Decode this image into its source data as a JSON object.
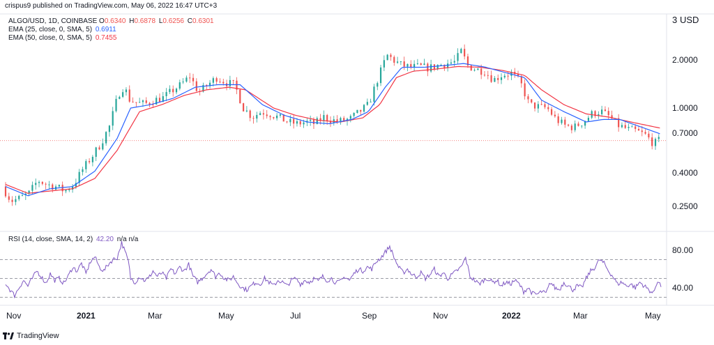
{
  "publisher": "crispus9 published on TradingView.com, May 06, 2022 16:47 UTC+3",
  "branding": "TradingView",
  "legend": {
    "symbol": "ALGO/USD, 1D, COINBASE",
    "ohlc": [
      {
        "label": "O",
        "value": "0.6340"
      },
      {
        "label": "H",
        "value": "0.6878"
      },
      {
        "label": "L",
        "value": "0.6256"
      },
      {
        "label": "C",
        "value": "0.6301"
      }
    ],
    "ema25": {
      "label": "EMA (25, close, 0, SMA, 5)",
      "value": "0.6911",
      "color": "#2962ff"
    },
    "ema50": {
      "label": "EMA (50, close, 0, SMA, 5)",
      "value": "0.7455",
      "color": "#f23645"
    },
    "rsi": {
      "label": "RSI (14, close, SMA, 14, 2)",
      "value": "42.20",
      "extra": "n/a n/a",
      "color": "#7e57c2"
    }
  },
  "currency": "USD",
  "currency_prefix": "3",
  "chart_data": [
    {
      "type": "candlestick",
      "scale": "log",
      "y_ticks": [
        "2.0000",
        "1.0000",
        "0.7000",
        "0.4000",
        "0.2500"
      ],
      "y_tick_values": [
        2.0,
        1.0,
        0.7,
        0.4,
        0.25
      ],
      "ylim": [
        0.2,
        3.0
      ],
      "x_ticks": [
        "Nov",
        "2021",
        "Mar",
        "May",
        "Jul",
        "Sep",
        "Nov",
        "2022",
        "Mar",
        "May"
      ],
      "colors": {
        "up": "#26a69a",
        "down": "#ef5350"
      },
      "price_line": 0.6301,
      "close": [
        [
          0,
          0.33
        ],
        [
          8,
          0.27
        ],
        [
          16,
          0.28
        ],
        [
          24,
          0.3
        ],
        [
          32,
          0.36
        ],
        [
          40,
          0.34
        ],
        [
          48,
          0.33
        ],
        [
          56,
          0.31
        ],
        [
          64,
          0.34
        ],
        [
          72,
          0.42
        ],
        [
          80,
          0.5
        ],
        [
          88,
          0.6
        ],
        [
          96,
          0.77
        ],
        [
          104,
          1.22
        ],
        [
          110,
          1.4
        ],
        [
          112,
          1.15
        ],
        [
          120,
          1.08
        ],
        [
          128,
          1.06
        ],
        [
          136,
          1.12
        ],
        [
          144,
          1.16
        ],
        [
          152,
          1.28
        ],
        [
          160,
          1.4
        ],
        [
          168,
          1.58
        ],
        [
          176,
          1.25
        ],
        [
          184,
          1.4
        ],
        [
          192,
          1.55
        ],
        [
          200,
          1.45
        ],
        [
          208,
          1.4
        ],
        [
          216,
          1.0
        ],
        [
          224,
          0.88
        ],
        [
          232,
          0.95
        ],
        [
          240,
          0.92
        ],
        [
          248,
          0.87
        ],
        [
          256,
          0.82
        ],
        [
          264,
          0.8
        ],
        [
          272,
          0.82
        ],
        [
          280,
          0.8
        ],
        [
          288,
          0.88
        ],
        [
          296,
          0.84
        ],
        [
          304,
          0.83
        ],
        [
          312,
          0.86
        ],
        [
          320,
          0.95
        ],
        [
          328,
          1.05
        ],
        [
          336,
          1.5
        ],
        [
          344,
          2.1
        ],
        [
          350,
          2.0
        ],
        [
          358,
          1.85
        ],
        [
          366,
          1.8
        ],
        [
          374,
          1.82
        ],
        [
          382,
          1.78
        ],
        [
          390,
          1.85
        ],
        [
          398,
          1.9
        ],
        [
          406,
          1.95
        ],
        [
          412,
          2.2
        ],
        [
          416,
          1.85
        ],
        [
          424,
          1.75
        ],
        [
          432,
          1.7
        ],
        [
          440,
          1.5
        ],
        [
          448,
          1.62
        ],
        [
          456,
          1.65
        ],
        [
          464,
          1.45
        ],
        [
          472,
          1.05
        ],
        [
          480,
          1.02
        ],
        [
          488,
          1.0
        ],
        [
          496,
          0.85
        ],
        [
          504,
          0.78
        ],
        [
          512,
          0.76
        ],
        [
          520,
          0.82
        ],
        [
          528,
          0.92
        ],
        [
          536,
          0.96
        ],
        [
          544,
          0.88
        ],
        [
          552,
          0.78
        ],
        [
          560,
          0.74
        ],
        [
          568,
          0.72
        ],
        [
          576,
          0.68
        ],
        [
          584,
          0.6
        ],
        [
          587,
          0.63
        ]
      ],
      "ema25": [
        [
          0,
          0.33
        ],
        [
          20,
          0.29
        ],
        [
          40,
          0.32
        ],
        [
          60,
          0.33
        ],
        [
          80,
          0.41
        ],
        [
          100,
          0.65
        ],
        [
          112,
          1.0
        ],
        [
          130,
          1.05
        ],
        [
          150,
          1.15
        ],
        [
          170,
          1.35
        ],
        [
          190,
          1.4
        ],
        [
          210,
          1.4
        ],
        [
          230,
          1.05
        ],
        [
          250,
          0.9
        ],
        [
          270,
          0.82
        ],
        [
          290,
          0.8
        ],
        [
          310,
          0.85
        ],
        [
          325,
          0.95
        ],
        [
          340,
          1.35
        ],
        [
          355,
          1.8
        ],
        [
          375,
          1.8
        ],
        [
          395,
          1.85
        ],
        [
          410,
          1.9
        ],
        [
          430,
          1.8
        ],
        [
          450,
          1.65
        ],
        [
          465,
          1.55
        ],
        [
          480,
          1.12
        ],
        [
          500,
          0.95
        ],
        [
          520,
          0.82
        ],
        [
          535,
          0.85
        ],
        [
          550,
          0.85
        ],
        [
          570,
          0.76
        ],
        [
          587,
          0.69
        ]
      ],
      "ema50": [
        [
          0,
          0.34
        ],
        [
          20,
          0.3
        ],
        [
          40,
          0.31
        ],
        [
          60,
          0.32
        ],
        [
          80,
          0.37
        ],
        [
          100,
          0.55
        ],
        [
          120,
          0.95
        ],
        [
          140,
          1.05
        ],
        [
          160,
          1.2
        ],
        [
          180,
          1.3
        ],
        [
          200,
          1.35
        ],
        [
          215,
          1.3
        ],
        [
          240,
          1.0
        ],
        [
          260,
          0.9
        ],
        [
          280,
          0.84
        ],
        [
          300,
          0.82
        ],
        [
          320,
          0.87
        ],
        [
          335,
          1.05
        ],
        [
          350,
          1.55
        ],
        [
          365,
          1.7
        ],
        [
          385,
          1.75
        ],
        [
          405,
          1.82
        ],
        [
          425,
          1.8
        ],
        [
          445,
          1.72
        ],
        [
          465,
          1.6
        ],
        [
          480,
          1.3
        ],
        [
          500,
          1.05
        ],
        [
          520,
          0.92
        ],
        [
          540,
          0.88
        ],
        [
          560,
          0.82
        ],
        [
          587,
          0.75
        ]
      ]
    },
    {
      "type": "line",
      "title": "RSI",
      "y_ticks": [
        "80.00",
        "40.00"
      ],
      "y_tick_values": [
        80,
        40
      ],
      "ylim": [
        25,
        95
      ],
      "bands": [
        70,
        50,
        30
      ],
      "series": [
        {
          "values": [
            [
              0,
              45
            ],
            [
              4,
              38
            ],
            [
              8,
              32
            ],
            [
              12,
              40
            ],
            [
              16,
              48
            ],
            [
              20,
              42
            ],
            [
              24,
              50
            ],
            [
              28,
              58
            ],
            [
              32,
              52
            ],
            [
              36,
              45
            ],
            [
              40,
              55
            ],
            [
              44,
              48
            ],
            [
              48,
              50
            ],
            [
              52,
              45
            ],
            [
              56,
              52
            ],
            [
              60,
              62
            ],
            [
              64,
              58
            ],
            [
              68,
              66
            ],
            [
              72,
              55
            ],
            [
              76,
              68
            ],
            [
              80,
              73
            ],
            [
              84,
              62
            ],
            [
              88,
              58
            ],
            [
              92,
              65
            ],
            [
              96,
              70
            ],
            [
              100,
              72
            ],
            [
              104,
              88
            ],
            [
              108,
              75
            ],
            [
              110,
              68
            ],
            [
              112,
              50
            ],
            [
              116,
              46
            ],
            [
              120,
              52
            ],
            [
              124,
              48
            ],
            [
              128,
              50
            ],
            [
              132,
              58
            ],
            [
              136,
              52
            ],
            [
              140,
              56
            ],
            [
              144,
              50
            ],
            [
              148,
              60
            ],
            [
              152,
              55
            ],
            [
              156,
              62
            ],
            [
              160,
              58
            ],
            [
              164,
              65
            ],
            [
              168,
              52
            ],
            [
              172,
              46
            ],
            [
              176,
              50
            ],
            [
              180,
              55
            ],
            [
              184,
              60
            ],
            [
              188,
              52
            ],
            [
              192,
              56
            ],
            [
              196,
              50
            ],
            [
              200,
              48
            ],
            [
              204,
              52
            ],
            [
              208,
              45
            ],
            [
              212,
              40
            ],
            [
              216,
              38
            ],
            [
              220,
              42
            ],
            [
              224,
              46
            ],
            [
              228,
              44
            ],
            [
              232,
              50
            ],
            [
              236,
              46
            ],
            [
              240,
              42
            ],
            [
              244,
              48
            ],
            [
              248,
              46
            ],
            [
              252,
              42
            ],
            [
              256,
              48
            ],
            [
              260,
              50
            ],
            [
              264,
              44
            ],
            [
              268,
              48
            ],
            [
              272,
              46
            ],
            [
              276,
              50
            ],
            [
              280,
              47
            ],
            [
              284,
              52
            ],
            [
              288,
              48
            ],
            [
              292,
              50
            ],
            [
              296,
              45
            ],
            [
              300,
              47
            ],
            [
              304,
              52
            ],
            [
              308,
              48
            ],
            [
              312,
              55
            ],
            [
              316,
              60
            ],
            [
              320,
              58
            ],
            [
              324,
              62
            ],
            [
              328,
              60
            ],
            [
              332,
              68
            ],
            [
              336,
              72
            ],
            [
              340,
              78
            ],
            [
              344,
              84
            ],
            [
              348,
              72
            ],
            [
              352,
              62
            ],
            [
              356,
              56
            ],
            [
              360,
              60
            ],
            [
              364,
              54
            ],
            [
              368,
              52
            ],
            [
              372,
              56
            ],
            [
              376,
              50
            ],
            [
              380,
              54
            ],
            [
              384,
              60
            ],
            [
              388,
              52
            ],
            [
              392,
              56
            ],
            [
              396,
              50
            ],
            [
              400,
              54
            ],
            [
              404,
              58
            ],
            [
              408,
              62
            ],
            [
              412,
              72
            ],
            [
              416,
              52
            ],
            [
              420,
              48
            ],
            [
              424,
              44
            ],
            [
              428,
              48
            ],
            [
              432,
              50
            ],
            [
              436,
              46
            ],
            [
              440,
              48
            ],
            [
              444,
              42
            ],
            [
              448,
              46
            ],
            [
              452,
              44
            ],
            [
              456,
              48
            ],
            [
              460,
              44
            ],
            [
              464,
              36
            ],
            [
              468,
              40
            ],
            [
              472,
              34
            ],
            [
              476,
              33
            ],
            [
              480,
              36
            ],
            [
              484,
              34
            ],
            [
              488,
              46
            ],
            [
              492,
              40
            ],
            [
              496,
              38
            ],
            [
              500,
              46
            ],
            [
              504,
              42
            ],
            [
              508,
              38
            ],
            [
              512,
              42
            ],
            [
              516,
              40
            ],
            [
              520,
              50
            ],
            [
              524,
              58
            ],
            [
              528,
              62
            ],
            [
              532,
              70
            ],
            [
              536,
              66
            ],
            [
              540,
              58
            ],
            [
              544,
              52
            ],
            [
              548,
              44
            ],
            [
              552,
              46
            ],
            [
              556,
              42
            ],
            [
              560,
              44
            ],
            [
              564,
              40
            ],
            [
              568,
              46
            ],
            [
              572,
              42
            ],
            [
              576,
              38
            ],
            [
              580,
              34
            ],
            [
              584,
              48
            ],
            [
              587,
              42
            ]
          ]
        }
      ]
    }
  ]
}
